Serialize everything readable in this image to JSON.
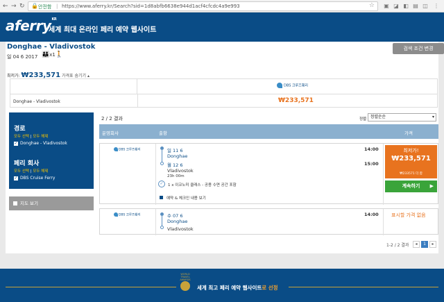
{
  "browser": {
    "secure_label": "안전함",
    "url": "https://www.aferry.kr/Search?sid=1d8abfb6638e944d1acf4cfcdc4a9e993"
  },
  "header": {
    "logo": "aferry",
    "logo_suffix": "KR",
    "tagline": "세계 최대 온라인 페리 예약 웹사이트"
  },
  "search": {
    "route": "Donghae - Vladivostok",
    "date": "일 04 6 2017",
    "passengers": "x1",
    "change_button": "검색 조건 변경"
  },
  "summary": {
    "lowest_label": "최저가:",
    "lowest_price": "₩233,571",
    "hide_label": "가격표 숨기기 ▴",
    "operator_logo_text": "DBS 크루즈훼리",
    "route": "Donghae - Vladivostok",
    "price": "₩233,571"
  },
  "sidebar": {
    "route_title": "경로",
    "route_select_all": "모두 선택",
    "route_clear_all": "모두 해제",
    "route_option": "Donghae - Vladivostok",
    "company_title": "페리 회사",
    "company_select_all": "모두 선택",
    "company_clear_all": "모두 해제",
    "company_option": "DBS Cruise Ferry",
    "map_button": "지도 보기",
    "link_separator": "|"
  },
  "results": {
    "count": "2 / 2 결과",
    "sort_label": "정렬",
    "sort_value": "정렬순순",
    "columns": {
      "operator": "운영회사",
      "departure": "출항",
      "price": "가격"
    },
    "card1": {
      "logo": "DBS 크루즈훼리",
      "dep_date": "일 11 6",
      "dep_port": "Donghae",
      "dep_time": "14:00",
      "arr_date": "월 12 6",
      "arr_port": "Vladivostok",
      "arr_time": "15:00",
      "duration": "23h 00m",
      "cabin": "1 x 이코노미 클래스 - 공용 수면 공간 포함",
      "details_link": "예약 & 체크인 내용 보기",
      "price_label": "최저가!",
      "price": "₩233,571",
      "price_note": "₩233571 더 합",
      "book_button": "계속하기"
    },
    "card2": {
      "logo": "DBS 크루즈훼리",
      "dep_date": "수 07 6",
      "dep_port": "Donghae",
      "dep_time": "14:00",
      "arr_port": "Vladivostok",
      "no_price": "표시할 가격 없음"
    },
    "pager": {
      "range": "1-2 / 2 결과",
      "prev": "◂",
      "page": "1",
      "next": "▸"
    }
  },
  "footer": {
    "award_main": "세계 최고 페리 예약 웹사이트",
    "award_highlight": "로 선정",
    "award_badge": "WORLD TRAVEL AWARDS"
  },
  "colors": {
    "brand_blue": "#0a4c86",
    "accent_orange": "#e8731f",
    "go_green": "#3aa43a",
    "gold": "#c7a23a"
  }
}
